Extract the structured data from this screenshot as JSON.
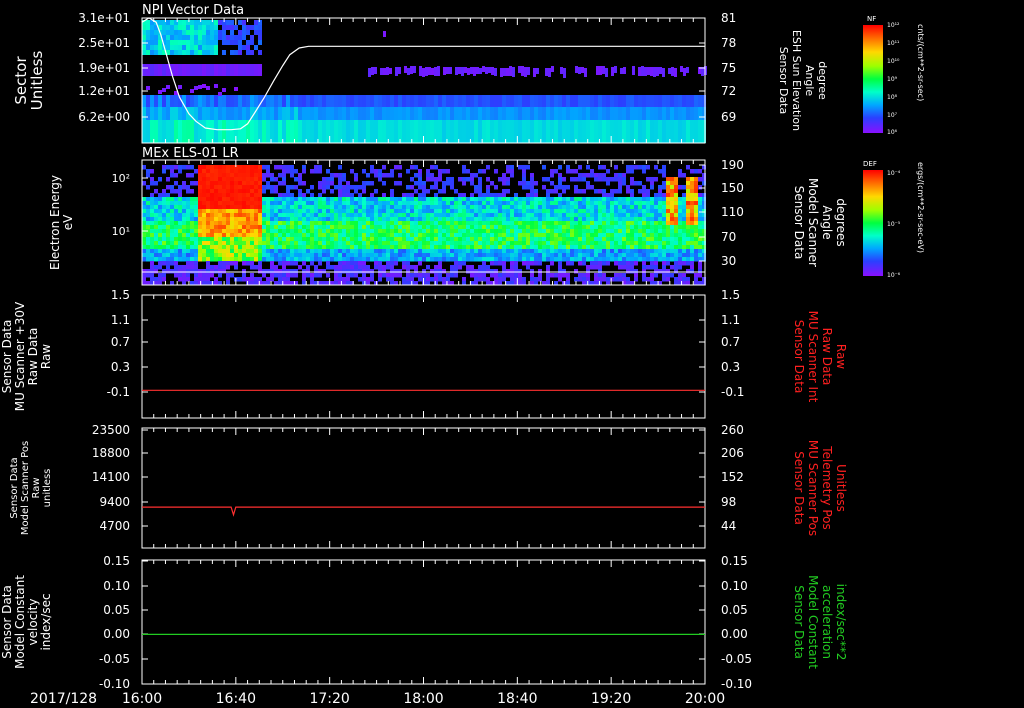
{
  "date_label": "2017/128",
  "time_ticks": [
    "16:00",
    "16:40",
    "17:20",
    "18:00",
    "18:40",
    "19:20",
    "20:00"
  ],
  "colorbars": [
    {
      "short_label": "NF",
      "unit": "cnts/(cm**2-sr-sec)",
      "ticks": [
        "10¹²",
        "10¹¹",
        "10¹⁰",
        "10⁹",
        "10⁸",
        "10⁷",
        "10⁶"
      ]
    },
    {
      "short_label": "DEF",
      "unit": "ergs/(cm**2-sr-sec-eV)",
      "ticks": [
        "10⁻⁴",
        "10⁻⁵",
        "10⁻⁶"
      ]
    }
  ],
  "chart_data": [
    {
      "type": "heatmap",
      "title": "NPI Vector Data",
      "ylabel_left": [
        "Sector",
        "Unitless"
      ],
      "ylabel_right": [
        "Sensor Data",
        "ESH Sun Elevation",
        "Angle",
        "degree"
      ],
      "y_ticks_left": [
        "3.1e+01",
        "2.5e+01",
        "1.9e+01",
        "1.2e+01",
        "6.2e+00"
      ],
      "y_ticks_right": [
        "81",
        "78",
        "75",
        "72",
        "69"
      ],
      "right_axis_range": [
        66,
        81
      ],
      "overlay_line": {
        "color": "#ffffff",
        "x_minutes": [
          0,
          3,
          6,
          8,
          10,
          13,
          16,
          20,
          23,
          27,
          32,
          38,
          42,
          45,
          48,
          52,
          56,
          60,
          63,
          67,
          71,
          75,
          240
        ],
        "y": [
          80.5,
          81,
          80.5,
          79,
          77,
          74,
          71.5,
          69.5,
          68.6,
          67.8,
          67.6,
          67.6,
          67.7,
          68.3,
          69.6,
          71.4,
          73.4,
          75.3,
          76.6,
          77.4,
          77.6,
          77.6,
          77.6
        ]
      }
    },
    {
      "type": "heatmap",
      "title": "MEx ELS-01 LR",
      "ylabel_left": [
        "Electron Energy",
        "eV"
      ],
      "ylabel_right": [
        "Sensor Data",
        "Model Scanner",
        "Angle",
        "degrees"
      ],
      "y_ticks_left": [
        "10²",
        "10¹"
      ],
      "y_ticks_right": [
        "190",
        "150",
        "110",
        "70",
        "30"
      ]
    },
    {
      "type": "line",
      "ylabel_left": [
        "Sensor Data",
        "MU Scanner +30V",
        "Raw Data",
        "Raw"
      ],
      "ylabel_right": [
        "Sensor Data",
        "MU Scanner Int",
        "Raw Data",
        "Raw"
      ],
      "y_ticks_left": [
        "1.5",
        "1.1",
        "0.7",
        "0.3",
        "-0.1"
      ],
      "y_ticks_right": [
        "1.5",
        "1.1",
        "0.7",
        "0.3",
        "-0.1"
      ],
      "ylim": [
        -0.5,
        1.5
      ],
      "series": [
        {
          "color": "#ff3030",
          "x_minutes": [
            0,
            240
          ],
          "y": [
            -0.05,
            -0.05
          ]
        }
      ]
    },
    {
      "type": "line",
      "ylabel_left": [
        "Sensor Data",
        "Model Scanner Pos",
        "Raw",
        "unitless"
      ],
      "ylabel_right": [
        "Sensor Data",
        "MU Scanner Pos",
        "Telemetry Pos",
        "Unitless"
      ],
      "y_ticks_left": [
        "23500",
        "18800",
        "14100",
        "9400",
        "4700"
      ],
      "y_ticks_right": [
        "260",
        "206",
        "152",
        "98",
        "44"
      ],
      "ylim": [
        0,
        23500
      ],
      "series": [
        {
          "color": "#ff3030",
          "x_minutes": [
            0,
            38,
            39,
            40,
            41,
            240
          ],
          "y": [
            8000,
            8000,
            6500,
            8000,
            8000,
            8000
          ]
        }
      ]
    },
    {
      "type": "line",
      "ylabel_left": [
        "Sensor Data",
        "Model Constant",
        "velocity",
        "index/sec"
      ],
      "ylabel_right": [
        "Sensor Data",
        "Model Constant",
        "acceleration",
        "index/sec**2"
      ],
      "y_ticks_left": [
        "0.15",
        "0.10",
        "0.05",
        "0.00",
        "-0.05",
        "-0.10"
      ],
      "y_ticks_right": [
        "0.15",
        "0.10",
        "0.05",
        "0.00",
        "-0.05",
        "-0.10"
      ],
      "ylim": [
        -0.1,
        0.15
      ],
      "series": [
        {
          "color": "#22cc22",
          "x_minutes": [
            0,
            240
          ],
          "y": [
            0,
            0
          ]
        }
      ]
    }
  ]
}
